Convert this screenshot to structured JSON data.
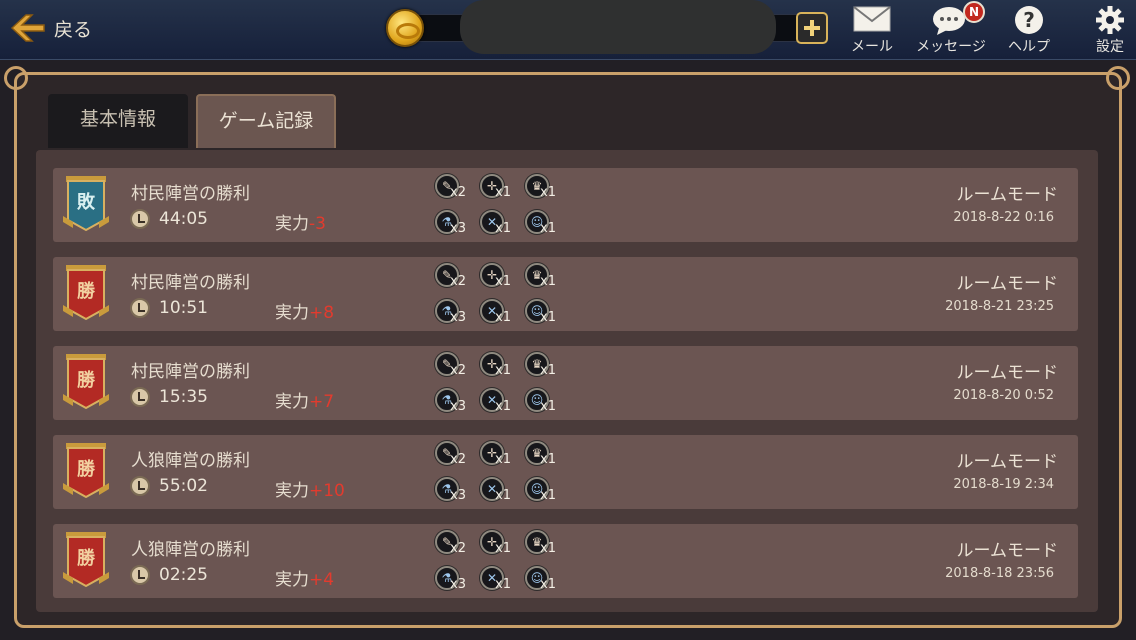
{
  "header": {
    "back_label": "戻る",
    "mail_label": "メール",
    "message_label": "メッセージ",
    "message_badge": "N",
    "help_label": "ヘルプ",
    "settings_label": "設定"
  },
  "tabs": [
    {
      "label": "基本情報",
      "active": false
    },
    {
      "label": "ゲーム記録",
      "active": true
    }
  ],
  "power_label": "実力",
  "records": [
    {
      "result": "敗",
      "result_type": "lose",
      "title": "村民陣営の勝利",
      "duration": "44:05",
      "power_delta": "-3",
      "roles": [
        "x2",
        "x1",
        "x1",
        "x3",
        "x1",
        "x1"
      ],
      "mode": "ルームモード",
      "date": "2018-8-22 0:16"
    },
    {
      "result": "勝",
      "result_type": "win",
      "title": "村民陣営の勝利",
      "duration": "10:51",
      "power_delta": "+8",
      "roles": [
        "x2",
        "x1",
        "x1",
        "x3",
        "x1",
        "x1"
      ],
      "mode": "ルームモード",
      "date": "2018-8-21 23:25"
    },
    {
      "result": "勝",
      "result_type": "win",
      "title": "村民陣営の勝利",
      "duration": "15:35",
      "power_delta": "+7",
      "roles": [
        "x2",
        "x1",
        "x1",
        "x3",
        "x1",
        "x1"
      ],
      "mode": "ルームモード",
      "date": "2018-8-20 0:52"
    },
    {
      "result": "勝",
      "result_type": "win",
      "title": "人狼陣営の勝利",
      "duration": "55:02",
      "power_delta": "+10",
      "roles": [
        "x2",
        "x1",
        "x1",
        "x3",
        "x1",
        "x1"
      ],
      "mode": "ルームモード",
      "date": "2018-8-19 2:34"
    },
    {
      "result": "勝",
      "result_type": "win",
      "title": "人狼陣営の勝利",
      "duration": "02:25",
      "power_delta": "+4",
      "roles": [
        "x2",
        "x1",
        "x1",
        "x3",
        "x1",
        "x1"
      ],
      "mode": "ルームモード",
      "date": "2018-8-18 23:56"
    }
  ],
  "role_icons": [
    "seer-icon",
    "hunter-icon",
    "crown-icon",
    "witch-icon",
    "guard-icon",
    "idiot-icon"
  ],
  "colors": {
    "win_banner": "#b32a24",
    "lose_banner": "#2a6f84",
    "delta": "#e23b2e",
    "frame": "#c9a06a"
  }
}
